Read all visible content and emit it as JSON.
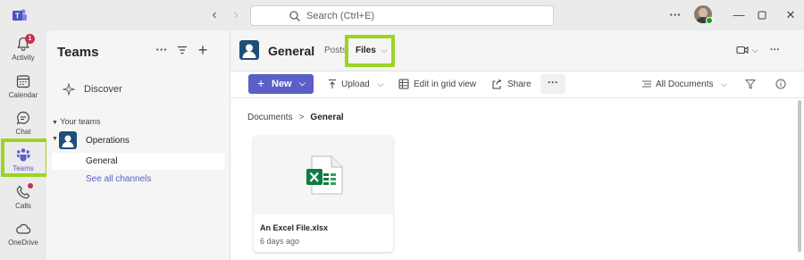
{
  "titlebar": {
    "search_placeholder": "Search (Ctrl+E)",
    "more_label": "···"
  },
  "appbar": {
    "items": [
      {
        "label": "Activity",
        "icon": "bell-icon",
        "badge": "1"
      },
      {
        "label": "Calendar",
        "icon": "calendar-icon"
      },
      {
        "label": "Chat",
        "icon": "chat-icon"
      },
      {
        "label": "Teams",
        "icon": "teams-icon",
        "active": true
      },
      {
        "label": "Calls",
        "icon": "phone-icon",
        "dot": true
      },
      {
        "label": "OneDrive",
        "icon": "cloud-icon"
      }
    ]
  },
  "teams_panel": {
    "title": "Teams",
    "discover_label": "Discover",
    "your_teams_label": "Your teams",
    "team_name": "Operations",
    "channel": "General",
    "see_all": "See all channels"
  },
  "channel": {
    "name": "General",
    "tabs": [
      "Posts",
      "Files"
    ],
    "active_tab": "Files"
  },
  "toolbar": {
    "new_label": "New",
    "upload_label": "Upload",
    "grid_label": "Edit in grid view",
    "share_label": "Share",
    "more_label": "···",
    "view_label": "All Documents"
  },
  "breadcrumb": {
    "root": "Documents",
    "sep": ">",
    "current": "General"
  },
  "file": {
    "name": "An Excel File.xlsx",
    "modified": "6 days ago",
    "icon": "excel-icon"
  },
  "colors": {
    "accent": "#5b5fc7",
    "highlight": "#9bd423",
    "excel": "#107c41"
  }
}
